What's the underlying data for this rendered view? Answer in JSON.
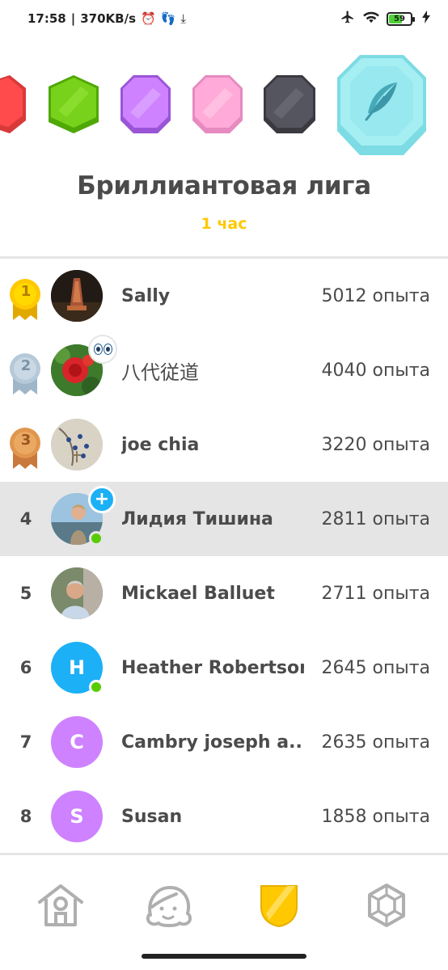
{
  "status_bar": {
    "time": "17:58",
    "speed": "370KB/s",
    "battery": "59"
  },
  "league": {
    "title": "Бриллиантовая лига",
    "time_left": "1 час"
  },
  "leaderboard": [
    {
      "rank": "1",
      "name": "Sally",
      "xp": "5012 опыта"
    },
    {
      "rank": "2",
      "name": "八代従道",
      "xp": "4040 опыта"
    },
    {
      "rank": "3",
      "name": "joe chia",
      "xp": "3220 опыта"
    },
    {
      "rank": "4",
      "name": "Лидия Тишина",
      "xp": "2811 опыта"
    },
    {
      "rank": "5",
      "name": "Mickael Balluet",
      "xp": "2711 опыта"
    },
    {
      "rank": "6",
      "name": "Heather Robertson",
      "xp": "2645 опыта",
      "initial": "H",
      "avatar_color": "#1cb0f6"
    },
    {
      "rank": "7",
      "name": "Cambry joseph a...",
      "xp": "2635 опыта",
      "initial": "C",
      "avatar_color": "#ce82ff"
    },
    {
      "rank": "8",
      "name": "Susan",
      "xp": "1858 опыта",
      "initial": "S",
      "avatar_color": "#ce82ff"
    }
  ],
  "colors": {
    "gold": "#ffc800",
    "highlight_row": "#e5e5e5",
    "online": "#58cc02",
    "plus_badge": "#1cb0f6"
  },
  "nav": {
    "items": [
      "home-icon",
      "characters-icon",
      "leagues-shield-icon",
      "gem-hexagon-icon"
    ],
    "active": "leagues-shield-icon"
  }
}
